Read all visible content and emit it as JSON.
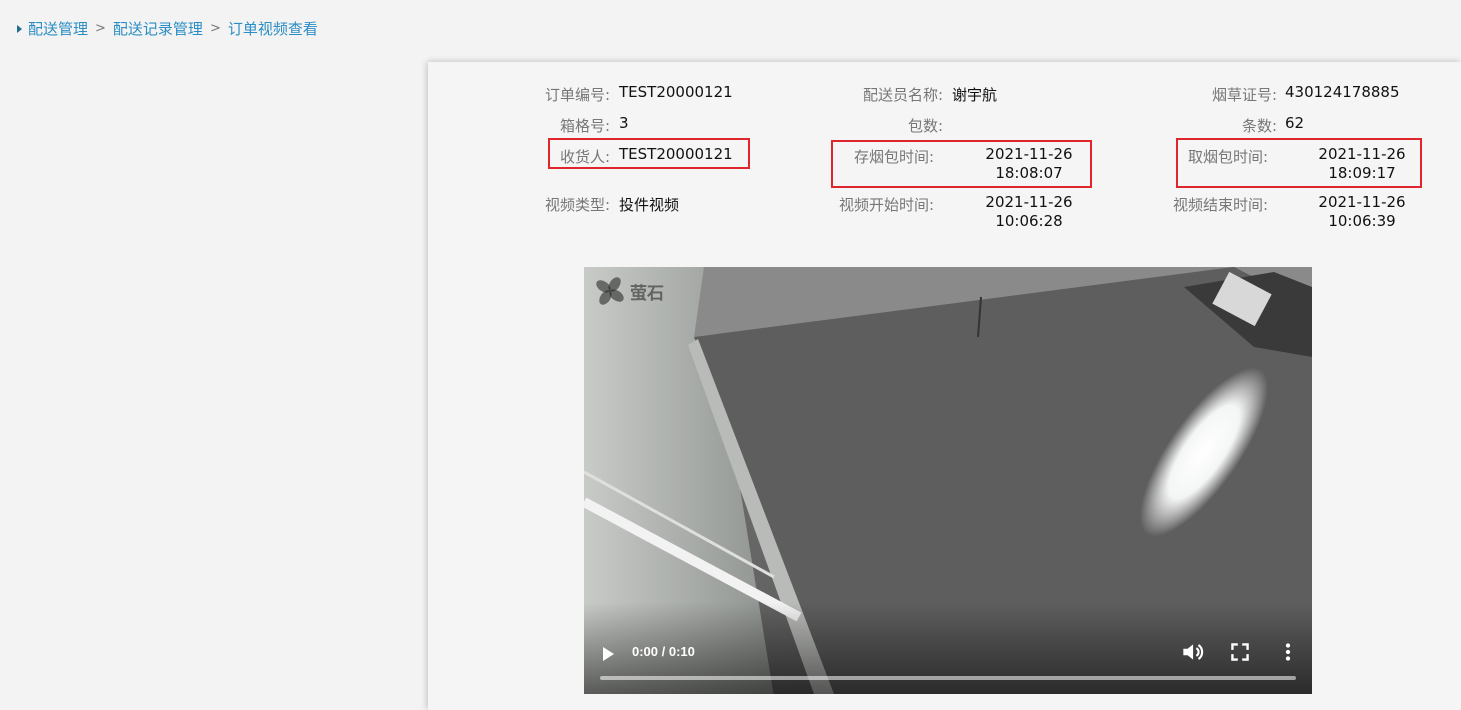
{
  "breadcrumb": {
    "items": [
      "配送管理",
      "配送记录管理",
      "订单视频查看"
    ],
    "separator": ">"
  },
  "order_info": {
    "order_no_label": "订单编号:",
    "order_no": "TEST20000121",
    "courier_label": "配送员名称:",
    "courier": "谢宇航",
    "license_label": "烟草证号:",
    "license": "430124178885",
    "box_label": "箱格号:",
    "box": "3",
    "packs_label": "包数:",
    "packs": "",
    "count_label": "条数:",
    "count": "62",
    "receiver_label": "收货人:",
    "receiver": "TEST20000121",
    "store_time_label": "存烟包时间:",
    "store_time_date": "2021-11-26",
    "store_time_clock": "18:08:07",
    "pickup_time_label": "取烟包时间:",
    "pickup_time_date": "2021-11-26",
    "pickup_time_clock": "18:09:17",
    "video_type_label": "视频类型:",
    "video_type": "投件视频",
    "video_start_label": "视频开始时间:",
    "video_start_date": "2021-11-26",
    "video_start_clock": "10:06:28",
    "video_end_label": "视频结束时间:",
    "video_end_date": "2021-11-26",
    "video_end_clock": "10:06:39"
  },
  "video": {
    "watermark": "萤石",
    "time_display": "0:00 / 0:10",
    "progress": 0.0,
    "icons": [
      "play-icon",
      "volume-icon",
      "fullscreen-icon",
      "more-options-icon"
    ]
  },
  "colors": {
    "breadcrumb": "#2b8dc5",
    "highlight_border": "#e0262d",
    "label": "#777777"
  }
}
